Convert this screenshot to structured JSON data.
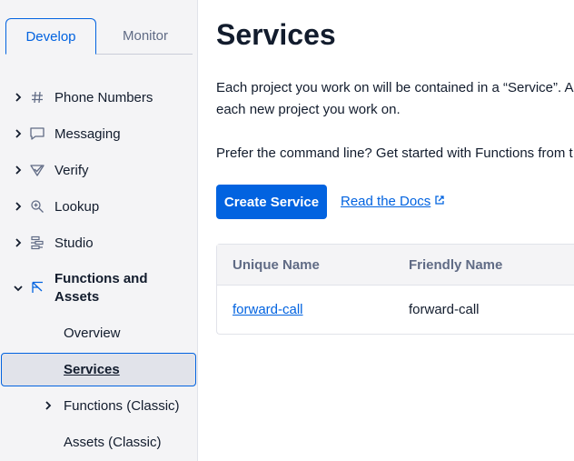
{
  "sidebar": {
    "tabs": {
      "develop": "Develop",
      "monitor": "Monitor"
    },
    "items": [
      {
        "label": "Phone Numbers",
        "icon": "hash-icon"
      },
      {
        "label": "Messaging",
        "icon": "chat-bubble-icon"
      },
      {
        "label": "Verify",
        "icon": "shield-check-icon"
      },
      {
        "label": "Lookup",
        "icon": "search-icon"
      },
      {
        "label": "Studio",
        "icon": "flow-icon"
      },
      {
        "label": "Functions and Assets",
        "icon": "functions-icon"
      }
    ],
    "subitems": {
      "overview": "Overview",
      "services": "Services",
      "functions_classic": "Functions (Classic)",
      "assets_classic": "Assets (Classic)"
    }
  },
  "main": {
    "title": "Services",
    "description_line1": "Each project you work on will be contained in a “Service”. A S",
    "description_line2": "each new project you work on.",
    "cli_text": "Prefer the command line? Get started with Functions from t",
    "create_button": "Create Service",
    "docs_link": "Read the Docs"
  },
  "table": {
    "headers": {
      "unique_name": "Unique Name",
      "friendly_name": "Friendly Name"
    },
    "rows": [
      {
        "unique_name": "forward-call",
        "friendly_name": "forward-call"
      }
    ]
  },
  "colors": {
    "accent": "#0263e0",
    "text": "#121c2d",
    "muted": "#606b85",
    "sidebar_bg": "#f4f4f6"
  }
}
